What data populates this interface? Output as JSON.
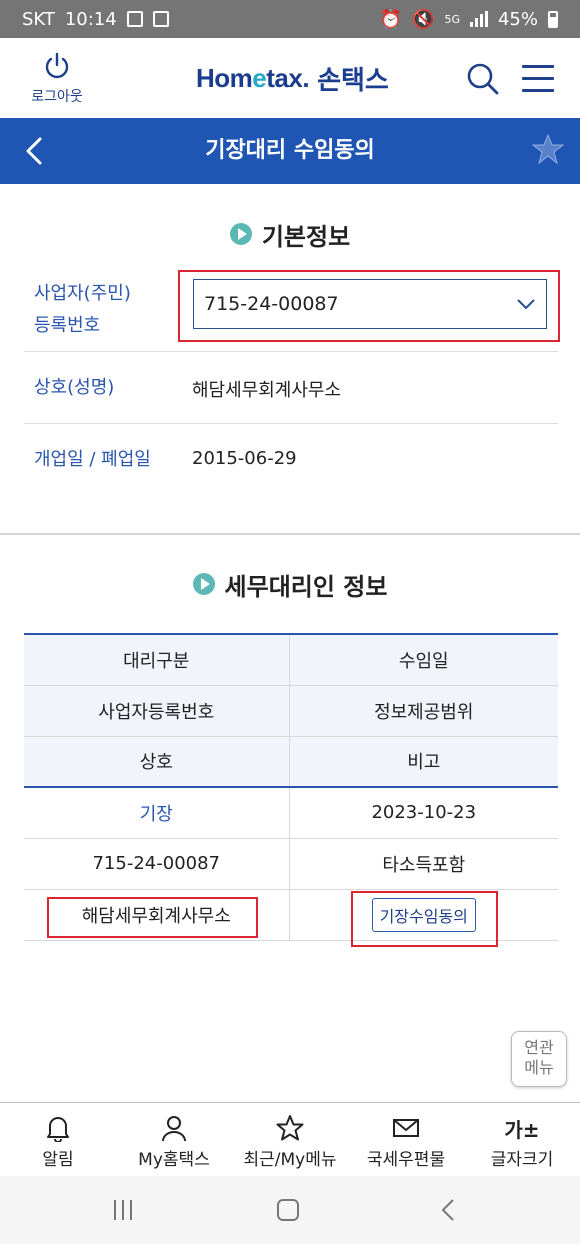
{
  "status_bar": {
    "carrier": "SKT",
    "time": "10:14",
    "battery": "45%",
    "network": "5G"
  },
  "header": {
    "logout_label": "로그아웃",
    "logo_text_a": "Hom",
    "logo_text_e": "e",
    "logo_text_b": "tax.",
    "logo_kr": "손택스"
  },
  "titlebar": {
    "title": "기장대리 수임동의"
  },
  "basic_info": {
    "heading": "기본정보",
    "business_no_label_line1": "사업자(주민)",
    "business_no_label_line2": "등록번호",
    "business_no_value": "715-24-00087",
    "name_label": "상호(성명)",
    "name_value": "해담세무회계사무소",
    "date_label": "개업일 / 폐업일",
    "date_value": "2015-06-29"
  },
  "agent_info": {
    "heading": "세무대리인 정보",
    "headers": [
      [
        "대리구분",
        "수임일"
      ],
      [
        "사업자등록번호",
        "정보제공범위"
      ],
      [
        "상호",
        "비고"
      ]
    ],
    "rows": [
      [
        "기장",
        "2023-10-23"
      ],
      [
        "715-24-00087",
        "타소득포함"
      ],
      [
        "해담세무회계사무소",
        "기장수임동의"
      ]
    ]
  },
  "related_menu": {
    "line1": "연관",
    "line2": "메뉴"
  },
  "bottom_nav": [
    {
      "label": "알림",
      "icon": "bell-icon"
    },
    {
      "label": "My홈택스",
      "icon": "person-icon"
    },
    {
      "label": "최근/My메뉴",
      "icon": "star-icon"
    },
    {
      "label": "국세우편물",
      "icon": "mail-icon"
    },
    {
      "label": "글자크기",
      "icon": "font-size-icon",
      "glyph": "가±"
    }
  ],
  "colors": {
    "brand_blue": "#1f56b4",
    "highlight_red": "#d9262f",
    "accent_teal": "#5cb8b3"
  }
}
